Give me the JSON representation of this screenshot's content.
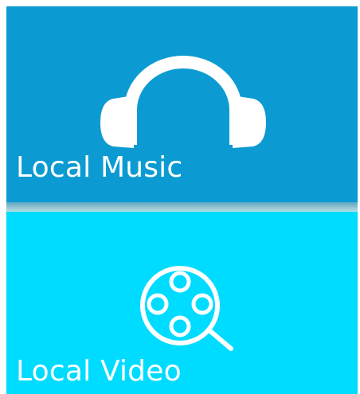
{
  "tiles": {
    "music": {
      "label": "Local Music",
      "icon": "headphones-icon",
      "background": "#0b9bd2"
    },
    "video": {
      "label": "Local Video",
      "icon": "film-reel-search-icon",
      "background": "#00dcff"
    }
  },
  "colors": {
    "icon": "#ffffff",
    "label": "#ffffff"
  }
}
